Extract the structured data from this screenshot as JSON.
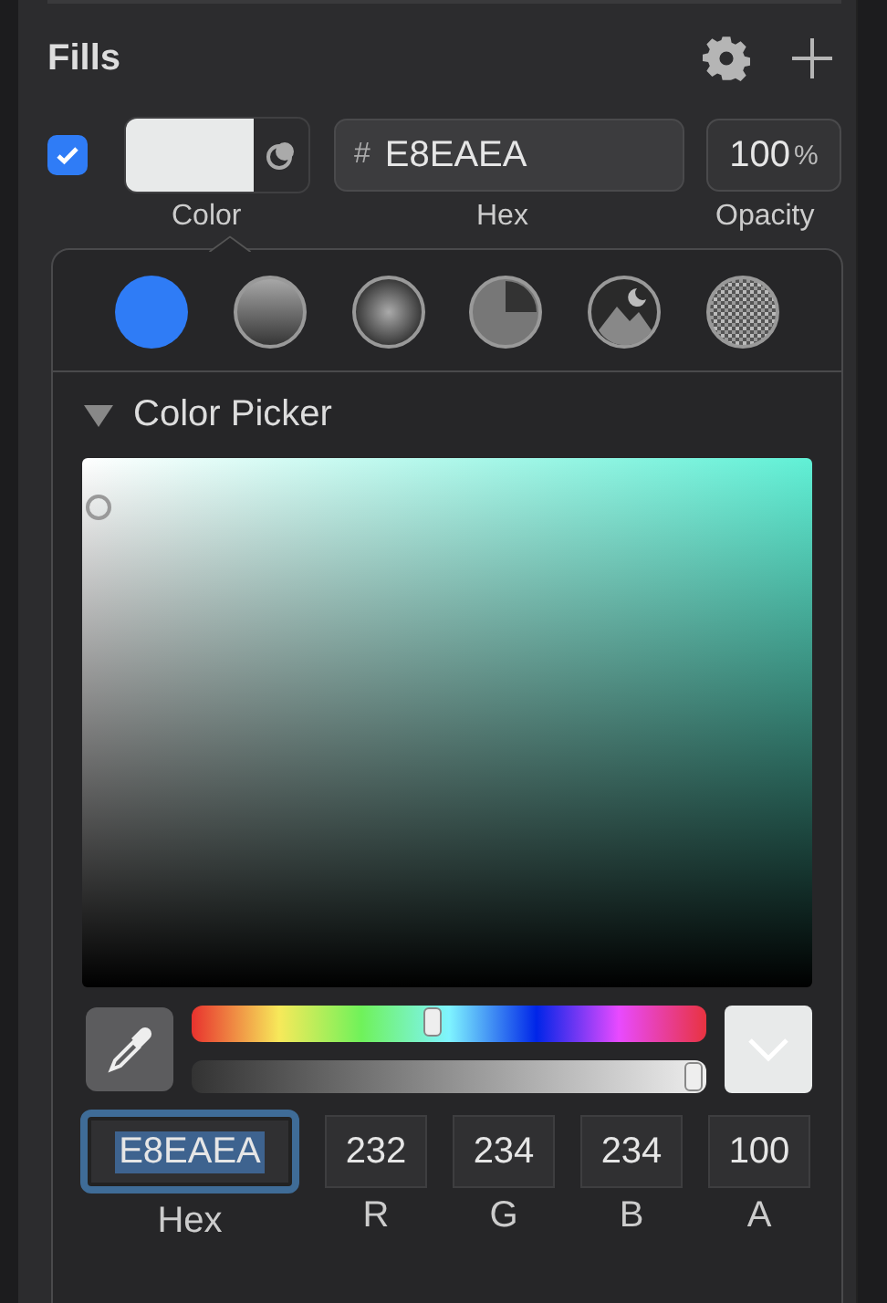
{
  "section": {
    "title": "Fills"
  },
  "fill": {
    "enabled": true,
    "hex_prefix": "#",
    "hex": "E8EAEA",
    "opacity": "100",
    "opacity_unit": "%",
    "labels": [
      "Color",
      "Hex",
      "Opacity"
    ]
  },
  "fill_types": [
    {
      "kind": "solid",
      "selected": true
    },
    {
      "kind": "linear",
      "selected": false
    },
    {
      "kind": "radial",
      "selected": false
    },
    {
      "kind": "angular",
      "selected": false
    },
    {
      "kind": "image",
      "selected": false
    },
    {
      "kind": "noise",
      "selected": false
    }
  ],
  "picker": {
    "title": "Color Picker",
    "expanded": true,
    "hue": {
      "level": 0.47
    },
    "alpha": {
      "level": 1.0
    },
    "fields": [
      {
        "label": "Hex",
        "value": "E8EAEA",
        "focused": true
      },
      {
        "label": "R",
        "value": "232",
        "focused": false
      },
      {
        "label": "G",
        "value": "234",
        "focused": false
      },
      {
        "label": "B",
        "value": "234",
        "focused": false
      },
      {
        "label": "A",
        "value": "100",
        "focused": false
      }
    ]
  }
}
